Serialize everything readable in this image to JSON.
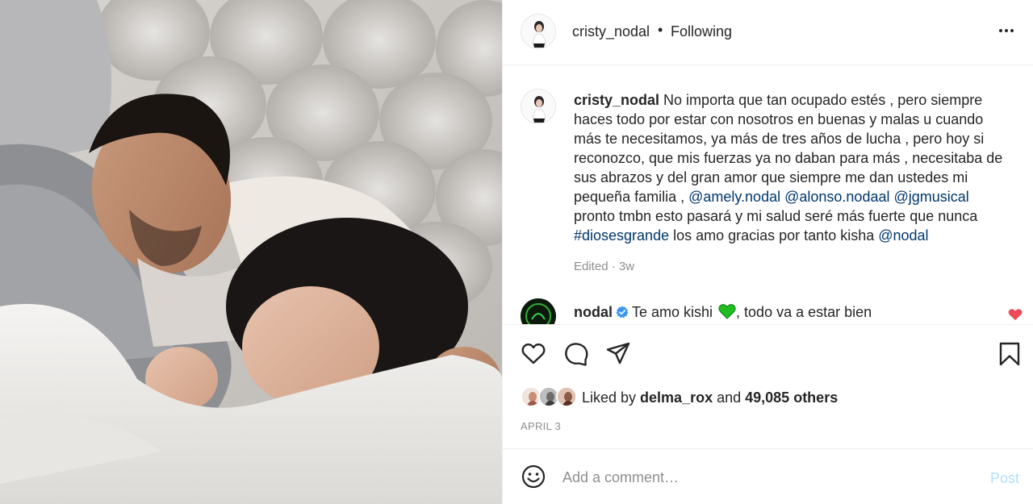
{
  "post": {
    "username": "cristy_nodal",
    "separator": "•",
    "following_label": "Following",
    "more_icon": "more-horizontal-icon"
  },
  "caption": {
    "username": "cristy_nodal",
    "text_1": " No importa que tan ocupado estés , pero siempre haces todo por estar con nosotros en buenas y malas u cuando más te necesitamos, ya más de tres años de lucha , pero hoy si reconozco, que mis fuerzas ya no daban para más , necesitaba de sus abrazos y del gran amor que siempre me dan ustedes mi pequeña familia , ",
    "mention_1": "@amely.nodal",
    "mention_2": "@alonso.nodaal",
    "mention_3": "@jgmusical",
    "text_2": " pronto tmbn esto pasará y mi salud seré más fuerte que nunca ",
    "hashtag": "#diosesgrande",
    "text_3": " los amo gracias por tanto kisha ",
    "mention_4": "@nodal",
    "edited": "Edited · 3w"
  },
  "reply": {
    "username": "nodal",
    "text_a": "Te amo kishi ",
    "text_b": ", todo va a estar bien"
  },
  "actions": {
    "like_icon": "heart-icon",
    "comment_icon": "comment-icon",
    "share_icon": "paper-plane-icon",
    "save_icon": "bookmark-icon"
  },
  "likes": {
    "prefix": "Liked by ",
    "liker": "delma_rox",
    "middle": " and ",
    "count": "49,085 others"
  },
  "date": "APRIL 3",
  "comment_box": {
    "placeholder": "Add a comment…",
    "post_label": "Post"
  },
  "colors": {
    "link": "#00376b",
    "post_button_disabled": "#b2dffc",
    "verified": "#3897f0",
    "like_red": "#ed4956"
  }
}
